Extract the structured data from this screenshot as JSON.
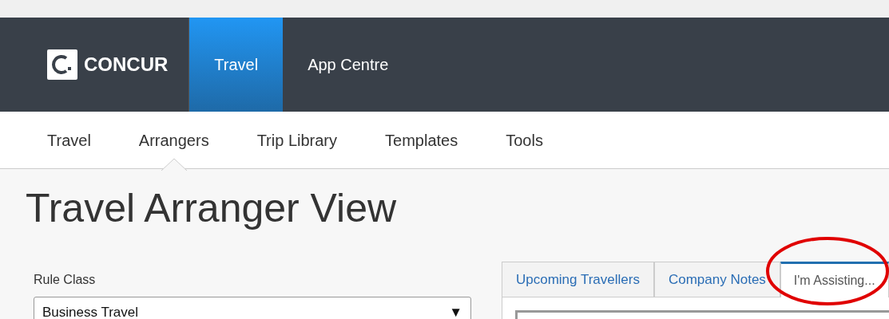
{
  "header": {
    "logo_text": "CONCUR",
    "apps": [
      {
        "label": "Travel",
        "selected": true
      },
      {
        "label": "App Centre",
        "selected": false
      }
    ]
  },
  "subnav": [
    {
      "label": "Travel",
      "selected": false
    },
    {
      "label": "Arrangers",
      "selected": true
    },
    {
      "label": "Trip Library",
      "selected": false
    },
    {
      "label": "Templates",
      "selected": false
    },
    {
      "label": "Tools",
      "selected": false
    }
  ],
  "page_title": "Travel Arranger View",
  "rule_class": {
    "label": "Rule Class",
    "value": "Business Travel",
    "arrow": "▼"
  },
  "tabs": [
    {
      "label": "Upcoming Travellers",
      "selected": false
    },
    {
      "label": "Company Notes",
      "selected": false
    },
    {
      "label": "I'm Assisting...",
      "selected": true
    }
  ]
}
